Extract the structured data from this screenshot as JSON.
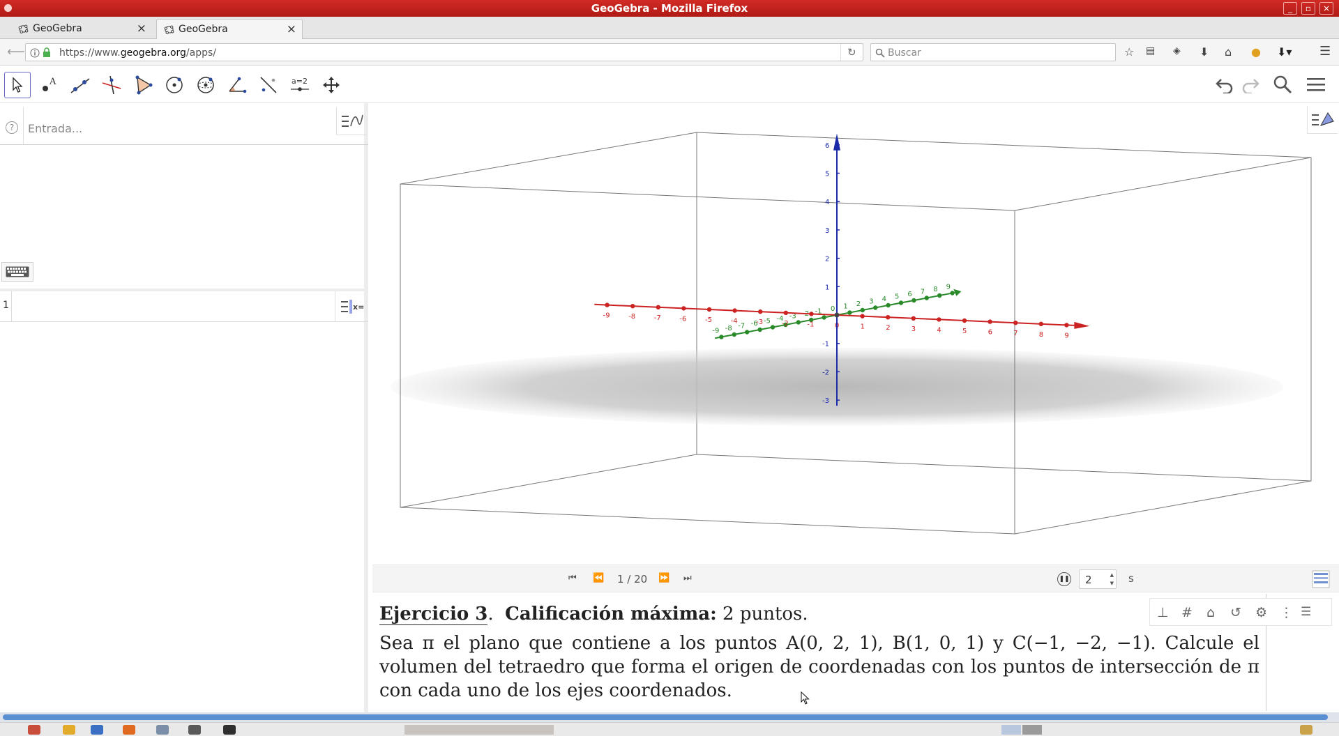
{
  "window": {
    "title": "GeoGebra - Mozilla Firefox"
  },
  "tabs": [
    {
      "label": "GeoGebra",
      "active": false
    },
    {
      "label": "GeoGebra",
      "active": true
    }
  ],
  "navbar": {
    "url_prefix": "https://www.",
    "url_domain": "geogebra.org",
    "url_path": "/apps/",
    "search_placeholder": "Buscar"
  },
  "toolbar": {
    "tools": [
      "move-tool",
      "point-tool",
      "line-tool",
      "perpendicular-line-tool",
      "polygon-tool",
      "circle-tool",
      "sphere-tool",
      "angle-tool",
      "reflect-tool",
      "slider-tool",
      "move-graphics-view-tool"
    ],
    "slider_label": "a=2"
  },
  "algebra": {
    "help": "?",
    "input_placeholder": "Entrada...",
    "cas_row_number": "1"
  },
  "graphics3d": {
    "x_axis_labels": [
      "-9",
      "-8",
      "-7",
      "-6",
      "-5",
      "-4",
      "-3",
      "-2",
      "-1",
      "0",
      "1",
      "2",
      "3",
      "4",
      "5",
      "6",
      "7",
      "8",
      "9"
    ],
    "y_axis_labels": [
      "-9",
      "-8",
      "-7",
      "-6",
      "-5",
      "-4",
      "-3",
      "-2",
      "-1",
      "0",
      "1",
      "2",
      "3",
      "4",
      "5",
      "6",
      "7",
      "8",
      "9"
    ],
    "z_axis_labels": [
      "6",
      "5",
      "4",
      "3",
      "2",
      "1",
      "-1",
      "-2",
      "-3"
    ],
    "colors": {
      "x_axis": "#cc2222",
      "y_axis": "#2a8a2a",
      "z_axis": "#1a2aa8",
      "box": "#666666",
      "plane": "#bdbdbd"
    }
  },
  "slides": {
    "counter": "1 / 20",
    "speed_value": "2",
    "speed_unit": "s"
  },
  "problem": {
    "ejercicio": "Ejercicio 3",
    "dot": ".",
    "calificacion": "Calificación máxima:",
    "puntos": "2 puntos.",
    "body": "Sea π el plano que contiene a los puntos A(0, 2, 1), B(1, 0, 1) y C(−1, −2, −1). Calcule el volumen del tetraedro que forma el origen de coordenadas con los puntos de intersección de π con cada uno de los ejes coordenados."
  }
}
